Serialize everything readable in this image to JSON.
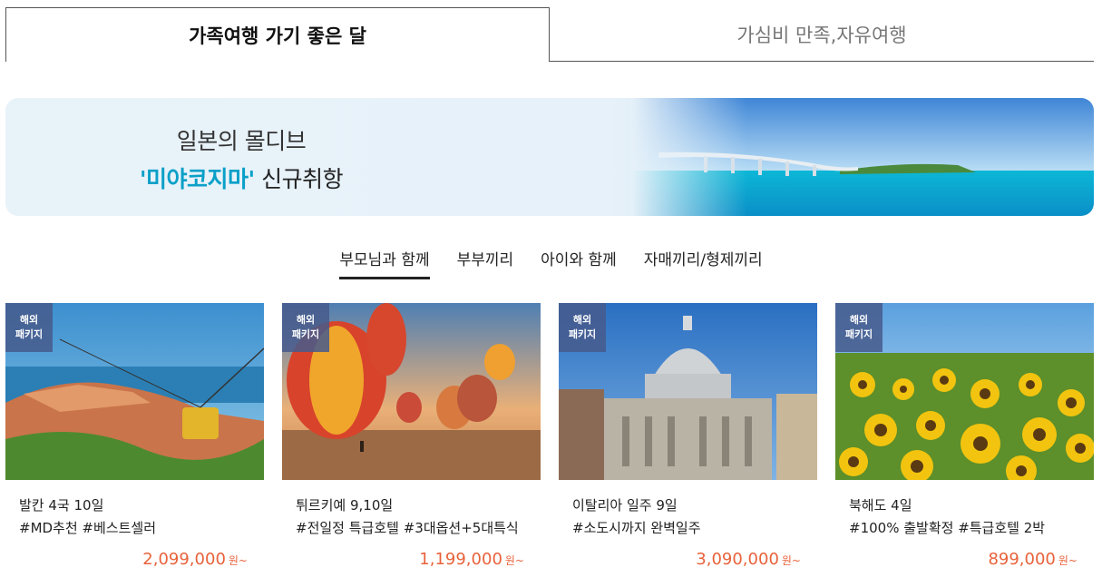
{
  "tabs": [
    {
      "label": "가족여행 가기 좋은 달",
      "active": true
    },
    {
      "label": "가심비 만족,자유여행",
      "active": false
    }
  ],
  "banner": {
    "line1": "일본의 몰디브",
    "highlight": "'미야코지마'",
    "line2_rest": " 신규취항"
  },
  "subtabs": [
    {
      "label": "부모님과 함께",
      "active": true
    },
    {
      "label": "부부끼리",
      "active": false
    },
    {
      "label": "아이와 함께",
      "active": false
    },
    {
      "label": "자매끼리/형제끼리",
      "active": false
    }
  ],
  "cards": [
    {
      "badge_line1": "해외",
      "badge_line2": "패키지",
      "title": "발칸 4국 10일",
      "tags": "#MD추천 #베스트셀러",
      "price": "2,099,000",
      "unit": "원~"
    },
    {
      "badge_line1": "해외",
      "badge_line2": "패키지",
      "title": "튀르키예 9,10일",
      "tags": "#전일정 특급호텔 #3대옵션+5대특식",
      "price": "1,199,000",
      "unit": "원~"
    },
    {
      "badge_line1": "해외",
      "badge_line2": "패키지",
      "title": "이탈리아 일주 9일",
      "tags": "#소도시까지 완벽일주",
      "price": "3,090,000",
      "unit": "원~"
    },
    {
      "badge_line1": "해외",
      "badge_line2": "패키지",
      "title": "북해도 4일",
      "tags": "#100% 출발확정 #특급호텔 2박",
      "price": "899,000",
      "unit": "원~"
    }
  ],
  "colors": {
    "accent_price": "#e8623a",
    "banner_highlight": "#0aa0c8",
    "badge_bg": "#465a8c"
  }
}
